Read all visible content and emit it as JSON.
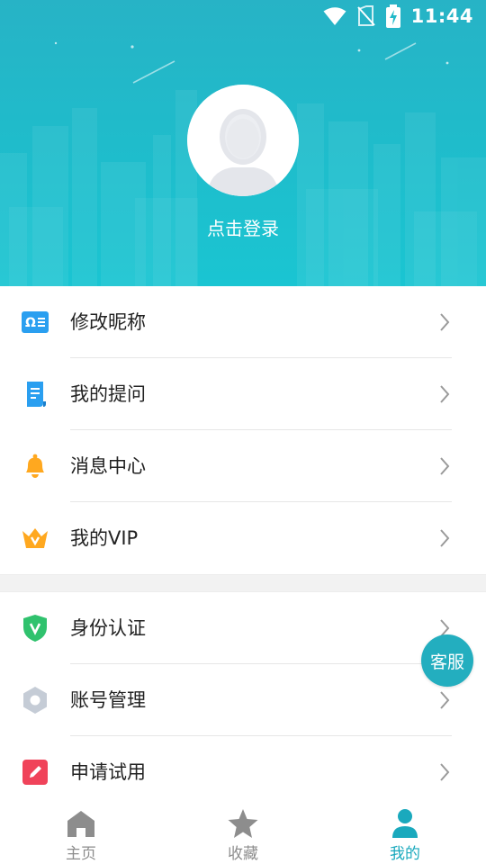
{
  "status_bar": {
    "time": "11:44",
    "icons": [
      "wifi-icon",
      "no-sim-icon",
      "battery-charging-icon"
    ]
  },
  "profile": {
    "avatar_icon": "avatar-placeholder-icon",
    "login_text": "点击登录"
  },
  "menu": {
    "group1": [
      {
        "label": "修改昵称",
        "icon": "nickname-card-icon",
        "color": "#2a9ff0"
      },
      {
        "label": "我的提问",
        "icon": "question-doc-icon",
        "color": "#2a9ff0"
      },
      {
        "label": "消息中心",
        "icon": "bell-icon",
        "color": "#ffa81f"
      },
      {
        "label": "我的VIP",
        "icon": "crown-icon",
        "color": "#ffa81f"
      }
    ],
    "group2": [
      {
        "label": "身份认证",
        "icon": "shield-v-icon",
        "color": "#30c26e"
      },
      {
        "label": "账号管理",
        "icon": "hexagon-nut-icon",
        "color": "#c5ccd6"
      },
      {
        "label": "申请试用",
        "icon": "pencil-icon",
        "color": "#f0435a"
      }
    ]
  },
  "service_button": {
    "label": "客服"
  },
  "bottom_nav": {
    "items": [
      {
        "label": "主页",
        "icon": "home-icon",
        "active": false
      },
      {
        "label": "收藏",
        "icon": "star-icon",
        "active": false
      },
      {
        "label": "我的",
        "icon": "person-icon",
        "active": true
      }
    ],
    "active_color": "#1aa9bd",
    "inactive_color": "#8d8d8d"
  },
  "colors": {
    "header": "#1fbccb",
    "accent": "#23aebf"
  }
}
